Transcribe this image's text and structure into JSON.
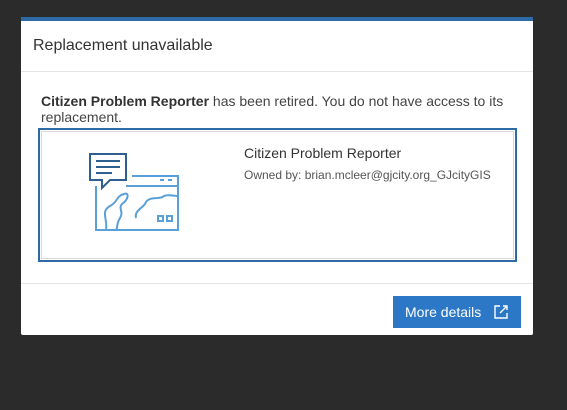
{
  "dialog": {
    "title": "Replacement unavailable",
    "message": {
      "app_name": "Citizen Problem Reporter",
      "text": " has been retired. You do not have access to its replacement."
    },
    "item": {
      "title": "Citizen Problem Reporter",
      "owner": "Owned by: brian.mcleer@gjcity.org_GJcityGIS",
      "thumbnail_icon": "map-app-icon"
    },
    "footer": {
      "more_details_label": "More details",
      "more_details_icon": "external-link-icon"
    }
  },
  "colors": {
    "backdrop": "#2b2b2b",
    "accent": "#2d6aa6",
    "button": "#2d77c7",
    "icon_stroke": "#5aa0d8"
  }
}
